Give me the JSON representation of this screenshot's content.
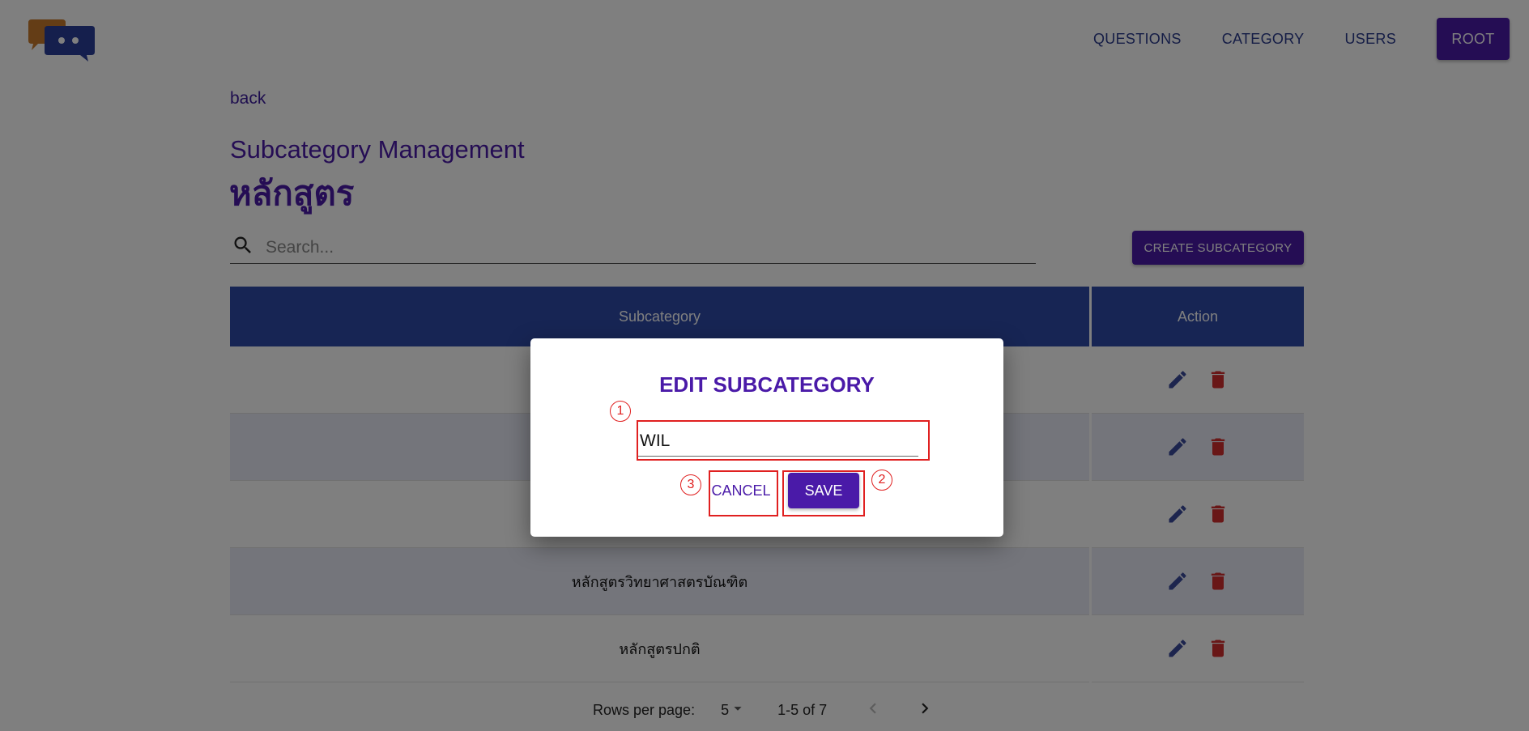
{
  "header": {
    "logo": "chat-bubbles-logo",
    "nav": [
      {
        "label": "QUESTIONS"
      },
      {
        "label": "CATEGORY"
      },
      {
        "label": "USERS"
      }
    ],
    "root_label": "ROOT"
  },
  "page": {
    "back_label": "back",
    "title": "Subcategory Management",
    "category_name": "หลักสูตร"
  },
  "search": {
    "placeholder": "Search...",
    "icon": "search-icon"
  },
  "create_button": "CREATE SUBCATEGORY",
  "table": {
    "columns": [
      "Subcategory",
      "Action"
    ],
    "rows": [
      {
        "subcategory": ""
      },
      {
        "subcategory": ""
      },
      {
        "subcategory": ""
      },
      {
        "subcategory": "หลักสูตรวิทยาศาสตรบัณฑิต"
      },
      {
        "subcategory": "หลักสูตรปกติ"
      }
    ],
    "action_icons": [
      "edit-icon",
      "delete-icon"
    ]
  },
  "pagination": {
    "rows_per_page_label": "Rows per page:",
    "rows_per_page_value": "5",
    "range_label": "1-5 of 7"
  },
  "dialog": {
    "title": "EDIT SUBCATEGORY",
    "field_value": "WIL",
    "cancel_label": "CANCEL",
    "save_label": "SAVE"
  },
  "annotations": [
    {
      "number": "1"
    },
    {
      "number": "2"
    },
    {
      "number": "3"
    }
  ],
  "colors": {
    "brand_purple": "#4a1aa8",
    "table_header_blue": "#2e4aa8",
    "alt_row": "#e8eaf6",
    "delete_red": "#d32f2f",
    "edit_blue": "#3a4a9c",
    "annotation_red": "#e02020"
  }
}
